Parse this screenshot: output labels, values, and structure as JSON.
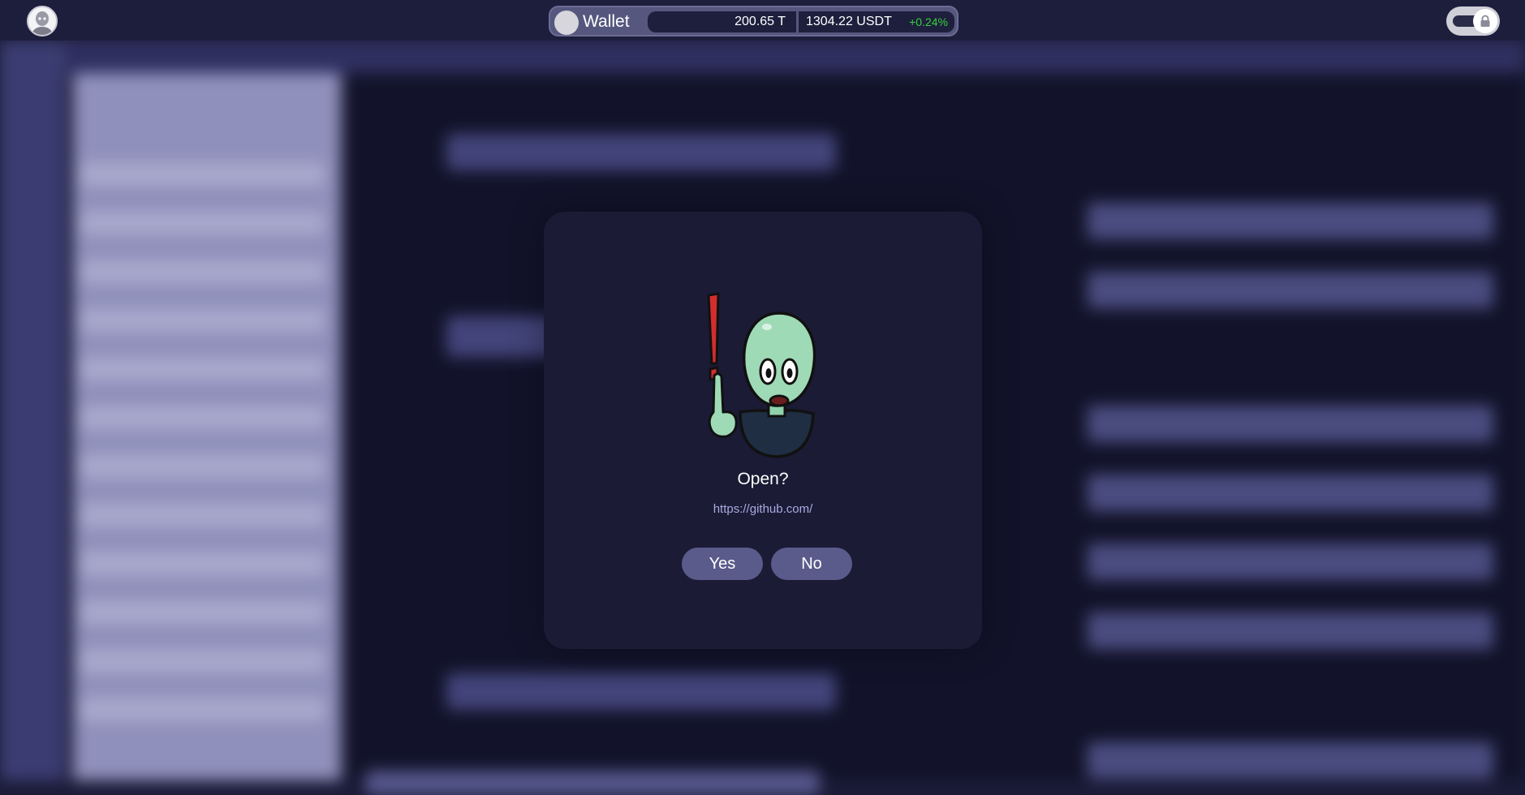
{
  "topbar": {
    "wallet_label": "Wallet",
    "balance_t": "200.65 T",
    "balance_usdt": "1304.22 USDT",
    "change": "+0.24%",
    "change_color": "#36d23c",
    "avatar_icon": "user-avatar-icon",
    "lock_icon": "lock-icon"
  },
  "dialog": {
    "title": "Open?",
    "url": "https://github.com/",
    "yes_label": "Yes",
    "no_label": "No",
    "illustration": "alien-mascot-warning-icon"
  },
  "colors": {
    "background": "#1b1c38",
    "modal": "#1b1b36",
    "button": "#5a5b8a",
    "url_text": "#a9aae0"
  }
}
